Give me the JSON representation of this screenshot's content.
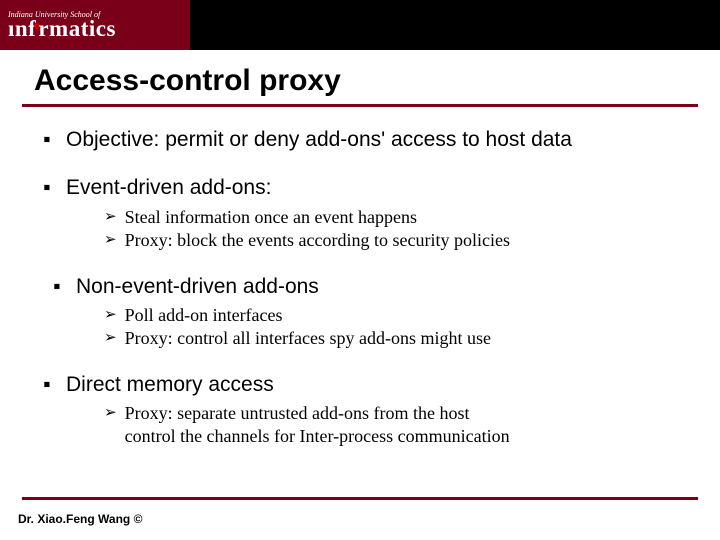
{
  "logo": {
    "top": "Indiana University School of",
    "main": "informatics"
  },
  "title": "Access-control proxy",
  "bullets": [
    {
      "text": "Objective: permit or deny add-ons' access to host data",
      "sub": []
    },
    {
      "text": "Event-driven add-ons:",
      "sub": [
        "Steal information once an event happens",
        "Proxy: block the events according to security policies"
      ]
    },
    {
      "text": "Non-event-driven add-ons",
      "indent": true,
      "sub": [
        "Poll add-on interfaces",
        "Proxy: control all interfaces spy add-ons might use"
      ]
    },
    {
      "text": "Direct memory access",
      "sub": [
        "Proxy: separate untrusted add-ons from the host\ncontrol the channels for Inter-process communication"
      ]
    }
  ],
  "footer": "Dr. Xiao.Feng Wang  ©"
}
